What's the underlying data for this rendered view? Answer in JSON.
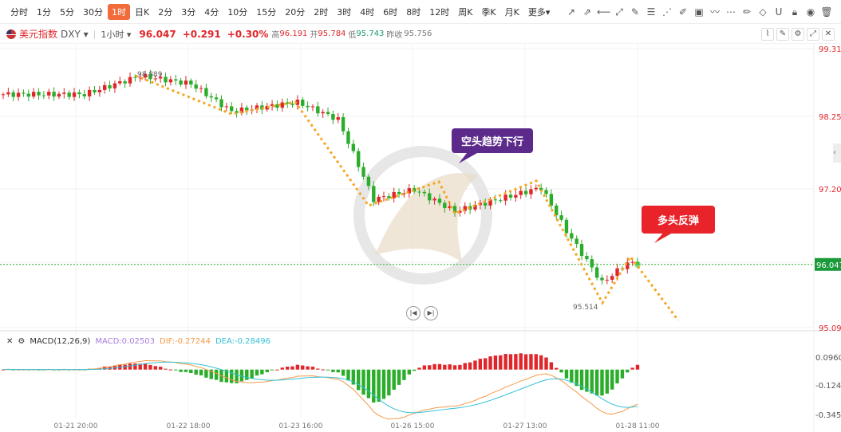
{
  "toolbar": {
    "timeframes": [
      "分时",
      "1分",
      "5分",
      "30分",
      "1时",
      "日K",
      "2分",
      "3分",
      "4分",
      "10分",
      "15分",
      "20分",
      "2时",
      "3时",
      "4时",
      "6时",
      "8时",
      "12时",
      "周K",
      "季K",
      "月K",
      "更多▾"
    ],
    "active": "1时"
  },
  "symbol": {
    "name": "美元指数",
    "code": "DXY ▾",
    "interval": "1小时 ▾",
    "price": "96.047",
    "change": "+0.291",
    "change_pct": "+0.30%",
    "high_label": "高",
    "high": "96.191",
    "open_label": "开",
    "open": "95.784",
    "low_label": "低",
    "low": "95.743",
    "prev_label": "昨收",
    "prev": "95.756"
  },
  "annotations": {
    "bear": "空头趋势下行",
    "bull": "多头反弹",
    "high_mark": "98.889",
    "low_mark": "95.514"
  },
  "macd": {
    "title": "MACD(12,26,9)",
    "macd": "MACD:0.02503",
    "dif": "DIF:-0.27244",
    "dea": "DEA:-0.28496"
  },
  "colors": {
    "up": "#e0262a",
    "down": "#2aad2a",
    "dif": "#f59a4a",
    "dea": "#33c2d6",
    "accent": "#f26b3a"
  },
  "chart_data": {
    "type": "candlestick",
    "price_ticks": [
      "99.311",
      "98.256",
      "97.201",
      "96.147",
      "95.092"
    ],
    "price_range": [
      95.092,
      99.311
    ],
    "current_price": "96.047",
    "macd_ticks": [
      "0.09601",
      "-0.12471",
      "-0.34543"
    ],
    "x_ticks": [
      "01-21 20:00",
      "01-22 18:00",
      "01-23 16:00",
      "01-26 15:00",
      "01-27 13:00",
      "01-28 11:00"
    ],
    "bars": 126,
    "close_keypoints": [
      [
        0,
        98.62
      ],
      [
        16,
        98.62
      ],
      [
        27,
        98.9
      ],
      [
        37,
        98.78
      ],
      [
        45,
        98.36
      ],
      [
        58,
        98.5
      ],
      [
        66,
        98.24
      ],
      [
        73,
        97.03
      ],
      [
        81,
        97.18
      ],
      [
        89,
        96.85
      ],
      [
        106,
        97.21
      ],
      [
        111,
        96.55
      ],
      [
        118,
        95.77
      ],
      [
        123,
        96.07
      ],
      [
        125,
        96.047
      ]
    ]
  }
}
